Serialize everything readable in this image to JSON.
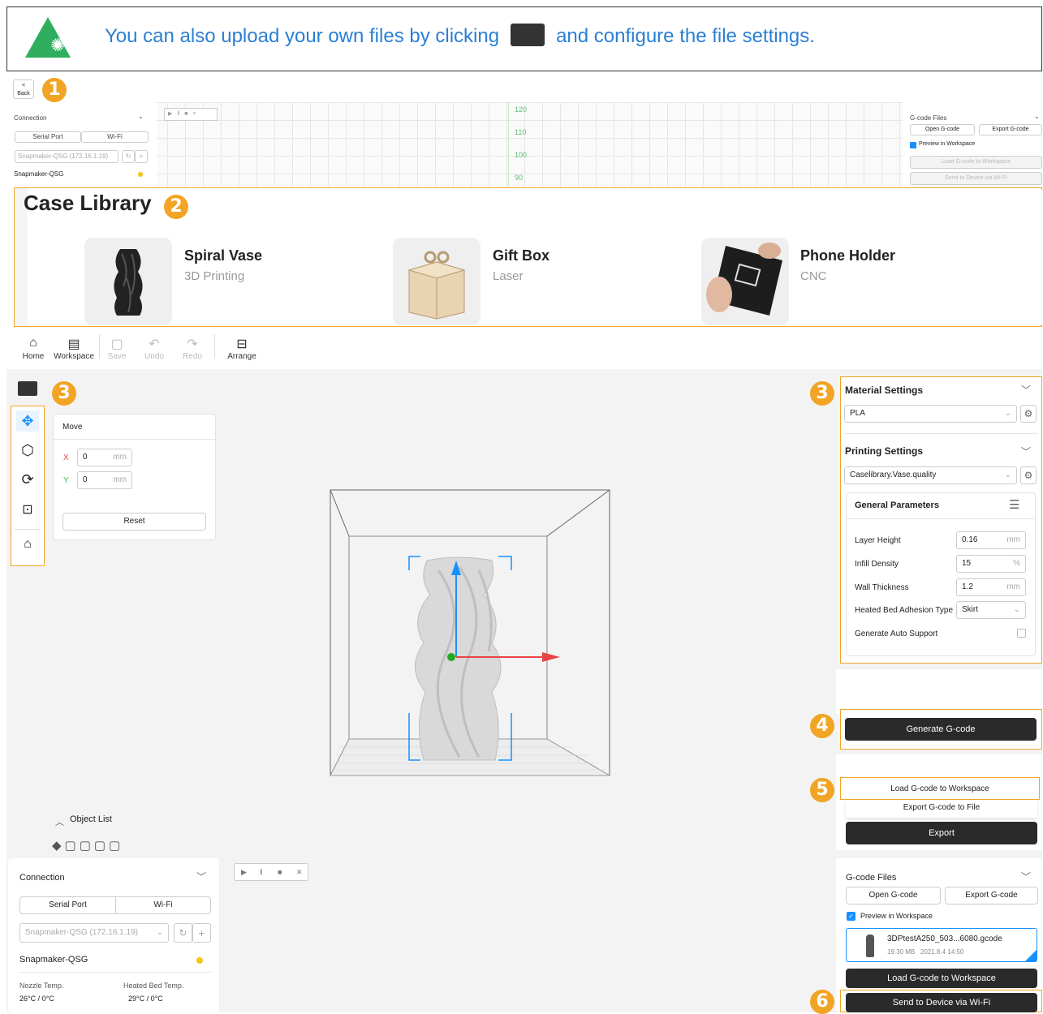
{
  "tip": {
    "text_before": "You can also upload your own files by clicking",
    "text_after": "and configure the file settings.",
    "bulb": "lightbulb-icon",
    "folder": "folder-icon"
  },
  "badges": {
    "b1": "1",
    "b2": "2",
    "b3": "3",
    "b4": "4",
    "b5": "5",
    "b6": "6"
  },
  "back": {
    "label": "Back",
    "arrow": "<"
  },
  "top_strip": {
    "connection_title": "Connection",
    "serial_port": "Serial Port",
    "wifi": "Wi-Fi",
    "device": "Snapmaker-QSG (172.16.1.19)",
    "device_name": "Snapmaker-QSG",
    "axis_ticks": [
      "120",
      "110",
      "100",
      "90"
    ],
    "gcode_title": "G-code Files",
    "open_gcode": "Open G-code",
    "export_gcode": "Export G-code",
    "preview": "Preview in Workspace",
    "load_ws": "Load G-code to Workspace",
    "send_wifi": "Send to Device via Wi-Fi"
  },
  "case_library": {
    "title": "Case Library",
    "cases": [
      {
        "title": "Spiral Vase",
        "subtitle": "3D Printing"
      },
      {
        "title": "Gift Box",
        "subtitle": "Laser"
      },
      {
        "title": "Phone Holder",
        "subtitle": "CNC"
      }
    ]
  },
  "toolbar": {
    "home": "Home",
    "workspace": "Workspace",
    "save": "Save",
    "undo": "Undo",
    "redo": "Redo",
    "arrange": "Arrange"
  },
  "move_panel": {
    "title": "Move",
    "x_label": "X",
    "x_value": "0",
    "y_label": "Y",
    "y_value": "0",
    "unit": "mm",
    "reset": "Reset"
  },
  "object_list": {
    "label": "Object List"
  },
  "material": {
    "title": "Material Settings",
    "value": "PLA"
  },
  "printing": {
    "title": "Printing Settings",
    "value": "Caselibrary.Vase.quality",
    "general_title": "General Parameters",
    "params": [
      {
        "label": "Layer Height",
        "value": "0.16",
        "unit": "mm"
      },
      {
        "label": "Infill Density",
        "value": "15",
        "unit": "%"
      },
      {
        "label": "Wall Thickness",
        "value": "1.2",
        "unit": "mm"
      }
    ],
    "adhesion_label": "Heated Bed Adhesion Type",
    "adhesion_value": "Skirt",
    "support_label": "Generate Auto Support"
  },
  "actions": {
    "generate": "Generate G-code",
    "load_ws": "Load G-code to Workspace",
    "export_file": "Export G-code to File",
    "export": "Export"
  },
  "bottom_connection": {
    "title": "Connection",
    "serial_port": "Serial Port",
    "wifi": "Wi-Fi",
    "device": "Snapmaker-QSG (172.16.1.19)",
    "device_name": "Snapmaker-QSG",
    "nozzle_label": "Nozzle Temp.",
    "nozzle_value": "26°C / 0°C",
    "bed_label": "Heated Bed Temp.",
    "bed_value": "29°C / 0°C"
  },
  "bottom_gcode": {
    "title": "G-code Files",
    "open_gcode": "Open G-code",
    "export_gcode": "Export G-code",
    "preview": "Preview in Workspace",
    "file_name": "3DPtestA250_503...6080.gcode",
    "file_meta": "19.30 MB   2021.8.4 14:50",
    "load_ws": "Load G-code to Workspace",
    "send_wifi": "Send to Device via Wi-Fi"
  },
  "colors": {
    "accent": "#f2a424",
    "tip_green": "#2eae5e",
    "tip_text": "#2a7fd4",
    "dark": "#2a2a2a",
    "select_blue": "#1890ff"
  }
}
